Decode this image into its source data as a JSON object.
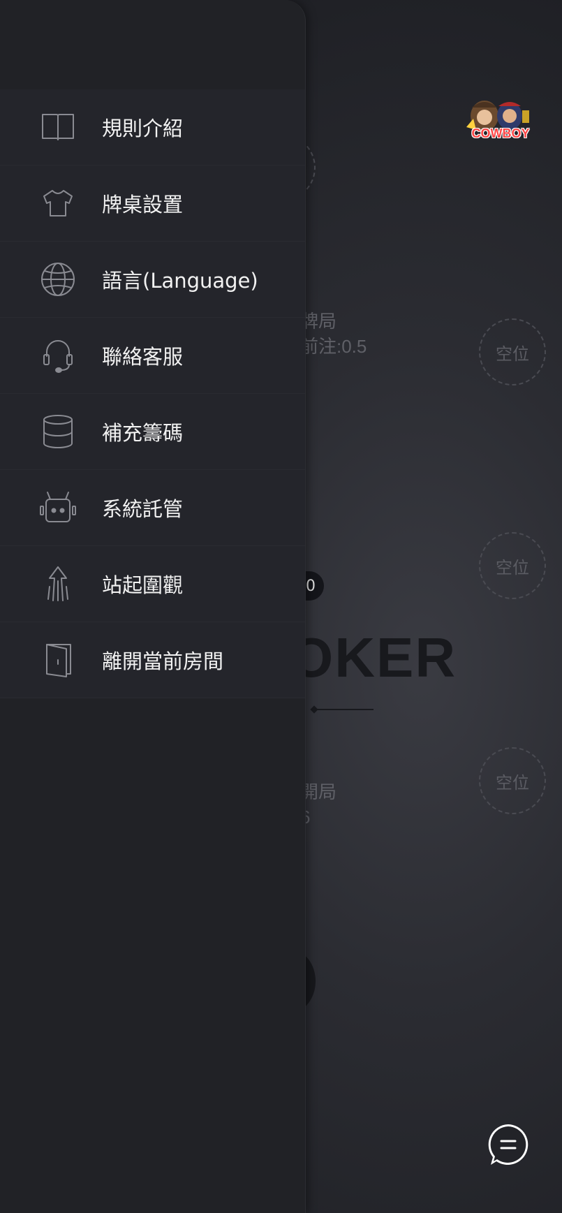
{
  "seats": {
    "empty_label": "空位"
  },
  "background": {
    "info_1_line_1": "牌局",
    "info_1_line_2": "前注:0.5",
    "info_2_line_1": "開局",
    "info_2_line_2": "6",
    "pill_text": "0",
    "brand_text": "OKER",
    "logo_text": "COWBOY"
  },
  "menu": {
    "items": [
      {
        "label": "規則介紹",
        "icon": "book-icon"
      },
      {
        "label": "牌桌設置",
        "icon": "shirt-icon"
      },
      {
        "label": "語言(Language)",
        "icon": "globe-icon"
      },
      {
        "label": "聯絡客服",
        "icon": "headset-icon"
      },
      {
        "label": "補充籌碼",
        "icon": "database-icon"
      },
      {
        "label": "系統託管",
        "icon": "robot-icon"
      },
      {
        "label": "站起圍觀",
        "icon": "stand-up-arrow-icon"
      },
      {
        "label": "離開當前房間",
        "icon": "door-exit-icon"
      }
    ]
  },
  "colors": {
    "drawer_bg": "#212226",
    "item_bg": "#24252b",
    "icon_stroke": "#8a8b92",
    "logo_red": "#ff4545"
  }
}
